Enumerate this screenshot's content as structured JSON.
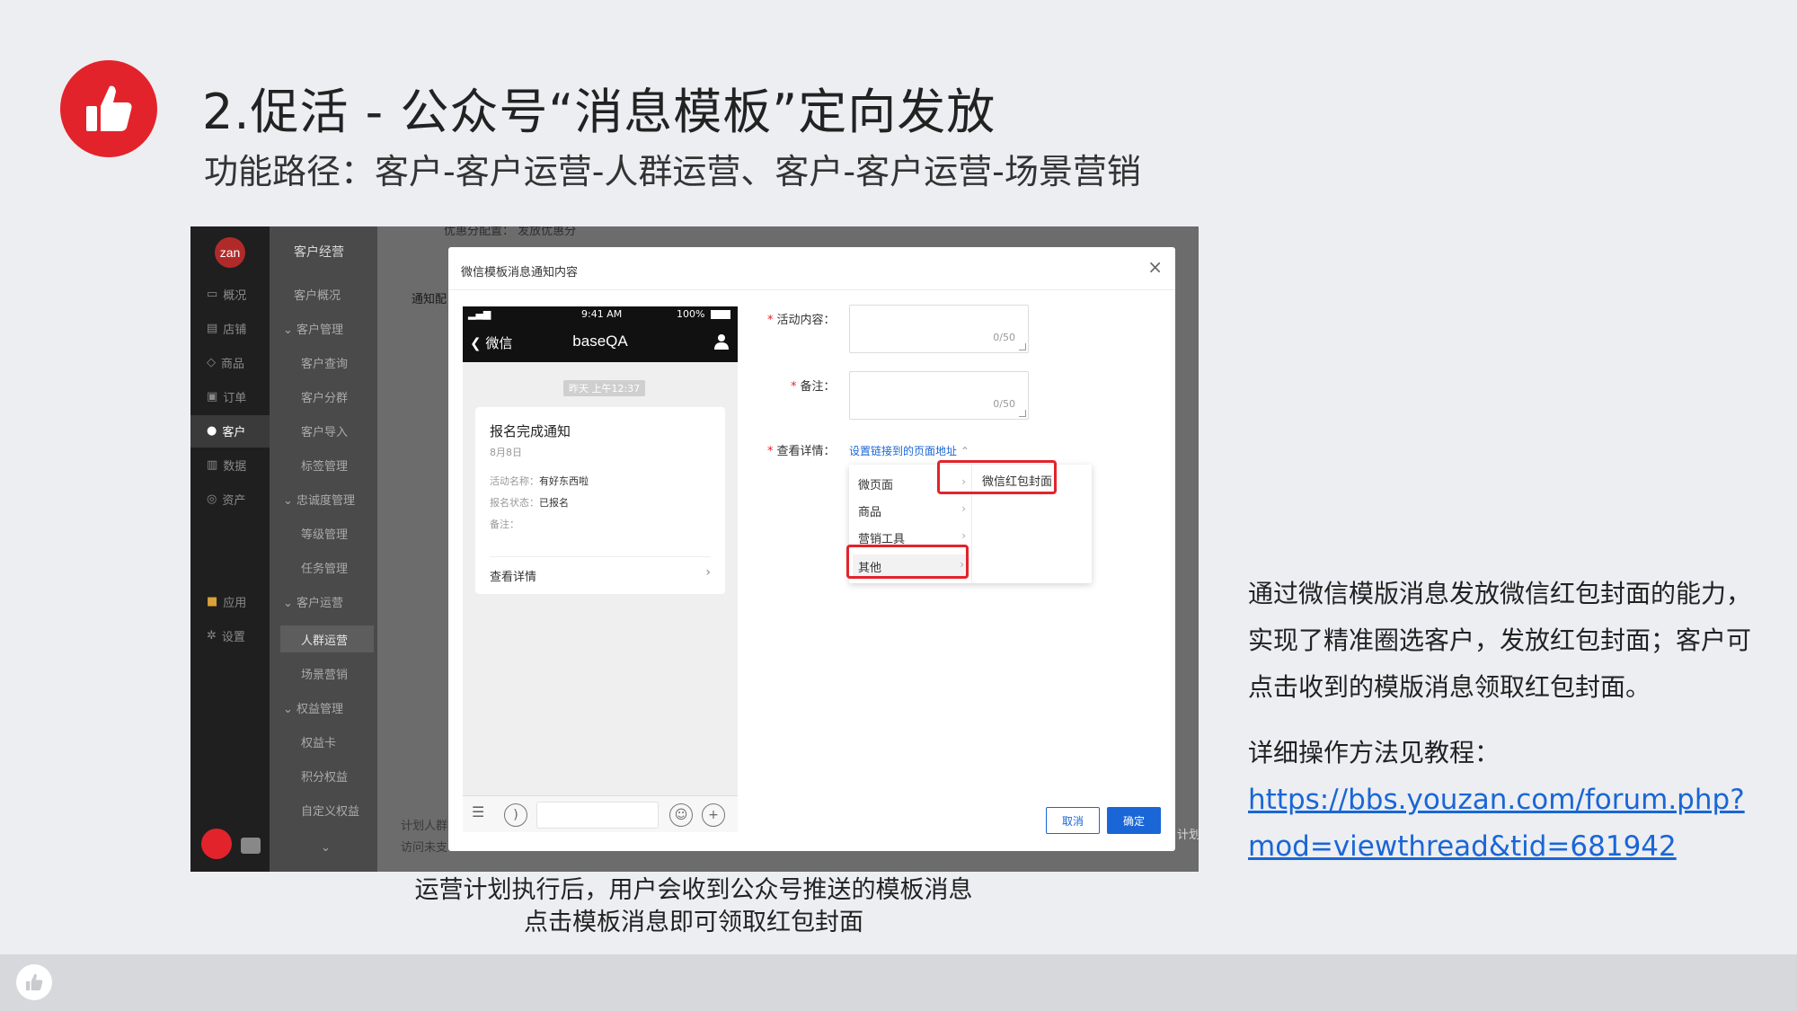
{
  "slide": {
    "title": "2.促活 - 公众号“消息模板”定向发放",
    "subtitle": "功能路径：客户-客户运营-人群运营、客户-客户运营-场景营销",
    "description": "通过微信模版消息发放微信红包封面的能力，实现了精准圈选客户，发放红包封面；客户可点击收到的模版消息领取红包封面。",
    "guide_label": "详细操作方法见教程：",
    "guide_url": "https://bbs.youzan.com/forum.php?mod=viewthread&tid=681942",
    "caption_line1": "运营计划执行后，用户会收到公众号推送的模板消息",
    "caption_line2": "点击模板消息即可领取红包封面",
    "brand_color": "#e3232b",
    "link_color": "#1a66d6"
  },
  "app": {
    "logo_text": "zan",
    "sidebar_main": [
      {
        "label": "概况",
        "icon": "monitor-icon"
      },
      {
        "label": "店铺",
        "icon": "store-icon"
      },
      {
        "label": "商品",
        "icon": "tag-icon"
      },
      {
        "label": "订单",
        "icon": "order-icon"
      },
      {
        "label": "客户",
        "icon": "person-icon",
        "active": true
      },
      {
        "label": "数据",
        "icon": "bar-chart-icon"
      },
      {
        "label": "资产",
        "icon": "coin-icon"
      },
      {
        "label": "应用",
        "icon": "apps-icon"
      },
      {
        "label": "设置",
        "icon": "gear-icon"
      }
    ],
    "sidebar_sub": {
      "header": "客户经营",
      "items": [
        "客户概况",
        "客户管理",
        "客户查询",
        "客户分群",
        "客户导入",
        "标签管理",
        "忠诚度管理",
        "等级管理",
        "任务管理",
        "客户运营",
        "人群运营",
        "场景营销",
        "权益管理",
        "权益卡",
        "积分权益",
        "自定义权益"
      ],
      "active": "人群运营"
    },
    "background_texts": {
      "top_partial": "优惠分配置：  发放优惠分",
      "notice_label": "通知配",
      "plan_label": "计划人群",
      "visit_label": "访问未支",
      "right_btn": "计划"
    }
  },
  "modal": {
    "title": "微信模板消息通知内容",
    "close_symbol": "×",
    "phone": {
      "status_time": "9:41 AM",
      "battery": "100%",
      "back_label": "微信",
      "account_name": "baseQA",
      "timestamp": "昨天 上午12:37",
      "card_title": "报名完成通知",
      "card_date": "8月8日",
      "field1_label": "活动名称：",
      "field1_value": "有好东西啦",
      "field2_label": "报名状态：",
      "field2_value": "已报名",
      "field3_label": "备注：",
      "detail_link": "查看详情"
    },
    "form": {
      "content_label": "活动内容：",
      "content_counter": "0/50",
      "remark_label": "备注：",
      "remark_counter": "0/50",
      "detail_label": "查看详情：",
      "detail_link": "设置链接到的页面地址",
      "cascader_items": [
        "微页面",
        "商品",
        "营销工具",
        "其他"
      ],
      "cascader_selected": "其他",
      "cascader_sub_item": "微信红包封面"
    },
    "cancel_label": "取消",
    "ok_label": "确定"
  }
}
